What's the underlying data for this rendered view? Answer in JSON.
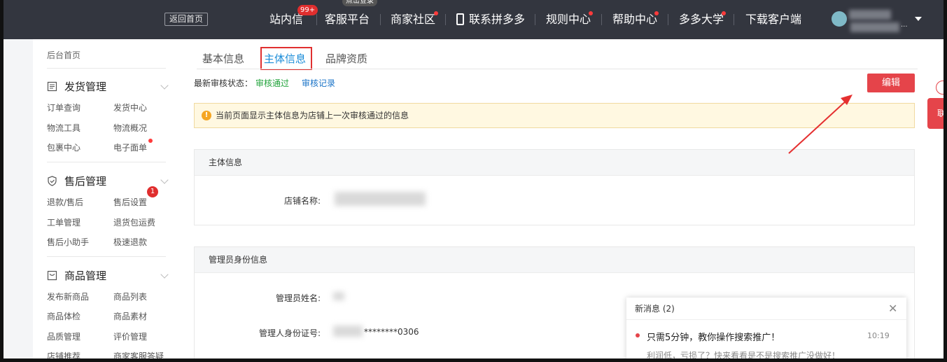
{
  "topnav": {
    "back_label": "返回首页",
    "items": [
      {
        "label": "站内信",
        "badge": "99+"
      },
      {
        "label": "客服平台",
        "tooltip": "点击登录"
      },
      {
        "label": "商家社区"
      },
      {
        "label": "联系拼多多"
      },
      {
        "label": "规则中心"
      },
      {
        "label": "帮助中心"
      },
      {
        "label": "多多大学"
      },
      {
        "label": "下载客户端"
      }
    ],
    "user_dots": "..."
  },
  "sidebar": {
    "home": "后台首页",
    "groups": [
      {
        "title": "发货管理",
        "links": [
          "订单查询",
          "发货中心",
          "物流工具",
          "物流概况",
          "包裹中心",
          "电子面单"
        ]
      },
      {
        "title": "售后管理",
        "badge": "1",
        "links": [
          "退款/售后",
          "售后设置",
          "工单管理",
          "退货包运费",
          "售后小助手",
          "极速退款"
        ]
      },
      {
        "title": "商品管理",
        "links": [
          "发布新商品",
          "商品列表",
          "商品体检",
          "商品素材",
          "品质管理",
          "评价管理",
          "店铺推荐",
          "商家客服答疑"
        ]
      }
    ]
  },
  "main": {
    "tabs": [
      "基本信息",
      "主体信息",
      "品牌资质"
    ],
    "status_label": "最新审核状态：",
    "status_value": "审核通过",
    "status_link": "审核记录",
    "edit_label": "编辑",
    "notice_icon": "!",
    "notice": "当前页面显示主体信息为店铺上一次审核通过的信息",
    "card1": {
      "title": "主体信息",
      "field_label": "店铺名称:"
    },
    "card2": {
      "title": "管理员身份信息",
      "name_label": "管理员姓名:",
      "id_label": "管理人身份证号:",
      "id_suffix": "********0306"
    }
  },
  "float": {
    "label": "联"
  },
  "message": {
    "header": "新消息 (2)",
    "close": "✕",
    "title": "只需5分钟，教你操作搜索推广！",
    "time": "10:19",
    "body": "利润低，亏损了？快来看看是不是搜索推广没做好！"
  },
  "colors": {
    "accent_red": "#e5444a",
    "tab_blue": "#1a8cd8",
    "status_green": "#22a33b",
    "nav_bg": "#33363f"
  }
}
